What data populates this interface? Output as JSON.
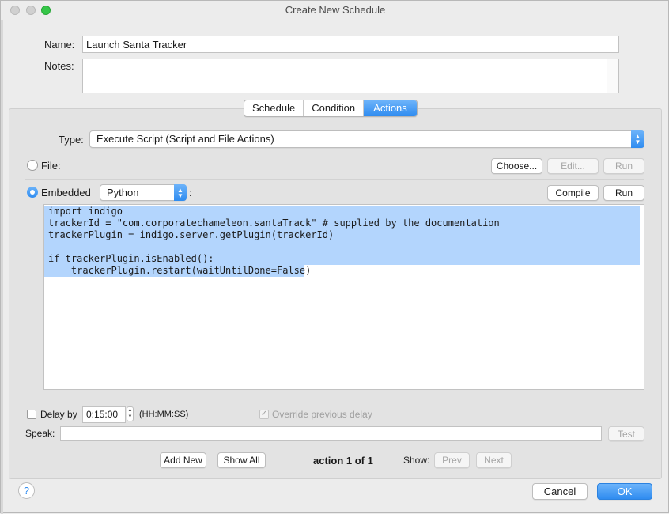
{
  "window": {
    "title": "Create New Schedule"
  },
  "form": {
    "name_label": "Name:",
    "name_value": "Launch Santa Tracker",
    "notes_label": "Notes:",
    "notes_value": ""
  },
  "tabs": [
    {
      "label": "Schedule",
      "active": false
    },
    {
      "label": "Condition",
      "active": false
    },
    {
      "label": "Actions",
      "active": true
    }
  ],
  "action": {
    "type_label": "Type:",
    "type_value": "Execute Script (Script and File Actions)",
    "file_label": "File:",
    "choose_label": "Choose...",
    "edit_label": "Edit...",
    "run_file_label": "Run",
    "embedded_label": "Embedded",
    "language_value": "Python",
    "colon": ":",
    "compile_label": "Compile",
    "run_label": "Run",
    "code_lines": [
      "import indigo",
      "trackerId = \"com.corporatechameleon.santaTrack\" # supplied by the documentation",
      "trackerPlugin = indigo.server.getPlugin(trackerId)",
      "",
      "if trackerPlugin.isEnabled():",
      "    trackerPlugin.restart(waitUntilDone=False)"
    ],
    "delay_label": "Delay by",
    "delay_value": "0:15:00",
    "delay_format": "(HH:MM:SS)",
    "override_label": "Override previous delay",
    "speak_label": "Speak:",
    "speak_value": "",
    "test_label": "Test"
  },
  "action_nav": {
    "add_new_label": "Add New",
    "show_all_label": "Show All",
    "counter": "action 1 of 1",
    "show_label": "Show:",
    "prev_label": "Prev",
    "next_label": "Next"
  },
  "footer": {
    "help_label": "?",
    "cancel_label": "Cancel",
    "ok_label": "OK"
  },
  "colors": {
    "accent": "#2f8cf0",
    "selection": "#b3d5fd",
    "window_bg": "#ececec"
  }
}
